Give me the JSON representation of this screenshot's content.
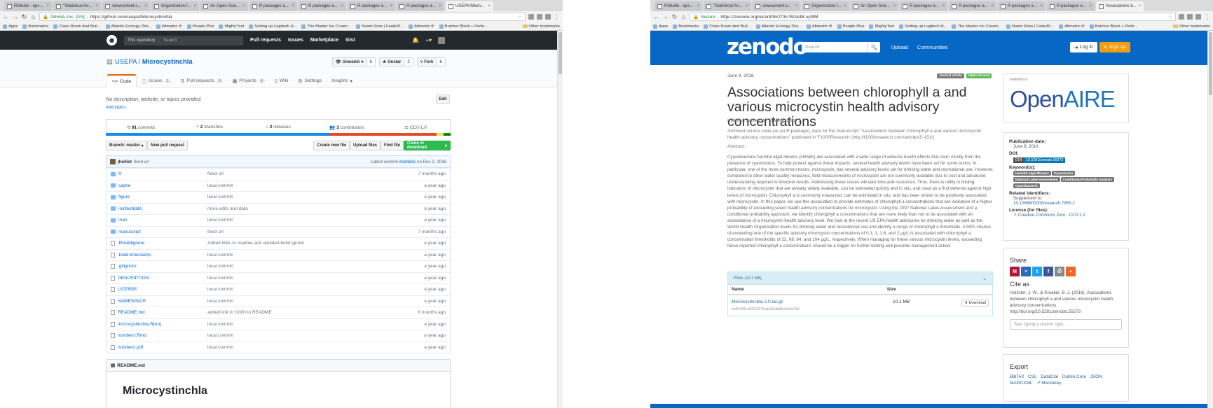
{
  "left": {
    "tabs": [
      "RStudio - eps...",
      "\"Statistical An...",
      "viewcontent.c...",
      "Organization f...",
      "An Open Scie...",
      "R packages a...",
      "R packages a...",
      "R packages a...",
      "R packages a...",
      "USEPA/Micro..."
    ],
    "url_owner": "GitHub, Inc. [US]",
    "url": "https://github.com/usepa/Microcystinchla",
    "bookmarks": [
      "Apps",
      "Bookmarks",
      "Class Room And Buil...",
      "Atlantic Ecology Divi...",
      "Altmetric it!",
      "People Plus",
      "MightyText",
      "Setting up Logitech H...",
      "The Master Ice Cream...",
      "Noam Ross | FasteR!...",
      "Altmetric it!",
      "Butcher Block + Perfe..."
    ],
    "other_bookmarks": "Other bookmarks",
    "gh": {
      "search_ctx": "This repository",
      "search_ph": "Search",
      "nav": [
        "Pull requests",
        "Issues",
        "Marketplace",
        "Gist"
      ],
      "owner": "USEPA",
      "sep": "/",
      "repo": "Microcystinchla",
      "unwatch": "Unwatch",
      "unwatch_n": "5",
      "unstar": "Unstar",
      "unstar_n": "2",
      "fork": "Fork",
      "fork_n": "6",
      "tabs": [
        {
          "label": "Code"
        },
        {
          "label": "Issues",
          "count": "1"
        },
        {
          "label": "Pull requests",
          "count": "0"
        },
        {
          "label": "Projects",
          "count": "0"
        },
        {
          "label": "Wiki"
        },
        {
          "label": "Settings"
        },
        {
          "label": "Insights"
        }
      ],
      "description": "No description, website, or topics provided.",
      "add_topics": "Add topics",
      "edit": "Edit",
      "commits_n": "91",
      "commits": "commits",
      "branches_n": "2",
      "branches": "branches",
      "releases_n": "2",
      "releases": "releases",
      "contributors_n": "3",
      "contributors": "contributors",
      "license": "CC0-1.0",
      "branch": "Branch: master",
      "new_pr": "New pull request",
      "create_file": "Create new file",
      "upload": "Upload files",
      "find": "Find file",
      "clone": "Clone or download",
      "commit_author": "jhollist",
      "commit_msg": "fixed url",
      "latest_commit": "Latest commit",
      "commit_sha": "ebeb8dc",
      "commit_date": "on Dec 2, 2016",
      "files": [
        {
          "name": "R",
          "msg": "fixed url",
          "age": "7 months ago",
          "dir": true
        },
        {
          "name": "cache",
          "msg": "local commit",
          "age": "a year ago",
          "dir": true
        },
        {
          "name": "figure",
          "msg": "local commit",
          "age": "a year ago",
          "dir": true
        },
        {
          "name": "inst/extdata",
          "msg": "more edits and data",
          "age": "a year ago",
          "dir": true
        },
        {
          "name": "man",
          "msg": "local commit",
          "age": "a year ago",
          "dir": true
        },
        {
          "name": "manuscript",
          "msg": "fixed url",
          "age": "7 months ago",
          "dir": true
        },
        {
          "name": ".Rbuildignore",
          "msg": "Added links to readme and updated build ignore",
          "age": "a year ago",
          "dir": false
        },
        {
          "name": ".build.timestamp",
          "msg": "local commit",
          "age": "a year ago",
          "dir": false
        },
        {
          "name": ".gitignore",
          "msg": "local commit",
          "age": "a year ago",
          "dir": false
        },
        {
          "name": "DESCRIPTION",
          "msg": "local commit",
          "age": "a year ago",
          "dir": false
        },
        {
          "name": "LICENSE",
          "msg": "local commit",
          "age": "a year ago",
          "dir": false
        },
        {
          "name": "NAMESPACE",
          "msg": "local commit",
          "age": "a year ago",
          "dir": false
        },
        {
          "name": "README.md",
          "msg": "added link to f1000 to README",
          "age": "8 months ago",
          "dir": false
        },
        {
          "name": "microcystinchla.Rproj",
          "msg": "local commit",
          "age": "a year ago",
          "dir": false
        },
        {
          "name": "numbers.Rmd",
          "msg": "local commit",
          "age": "a year ago",
          "dir": false
        },
        {
          "name": "numbers.pdf",
          "msg": "local commit",
          "age": "a year ago",
          "dir": false
        }
      ],
      "readme_file": "README.md",
      "readme_title": "Microcystinchla",
      "lang_colors": [
        "#198ce7",
        "#e34c26",
        "#f1e05a",
        "#178600"
      ]
    }
  },
  "right": {
    "tabs": [
      "RStudio - eps...",
      "\"Statistical An...",
      "viewcontent.c...",
      "Organization f...",
      "An Open Scie...",
      "R packages a...",
      "R packages a...",
      "R packages a...",
      "R packages a...",
      "Associations b..."
    ],
    "secure": "Secure",
    "url": "https://zenodo.org/record/55273#.WUk4B-vyt9M",
    "bookmarks": [
      "Apps",
      "Bookmarks",
      "Class Room And Buil...",
      "Atlantic Ecology Divi...",
      "Altmetric it!",
      "People Plus",
      "MightyText",
      "Setting up Logitech H...",
      "The Master Ice Cream...",
      "Noam Ross | FasteR!...",
      "Altmetric it!",
      "Butcher Block + Perfe..."
    ],
    "other_bookmarks": "Other bookmarks",
    "z": {
      "logo": "zenodo",
      "search_ph": "Search",
      "nav": [
        "Upload",
        "Communities"
      ],
      "login": "Log in",
      "signup": "Sign up",
      "date": "June 9, 2016",
      "badge1": "Journal article",
      "badge2": "Open Access",
      "title": "Associations between chlorophyll a and various microcystin health advisory concentrations",
      "authors": "Hollister, Jeffrey W.; Kreakie, Betty J.",
      "blurb": "Archived source code (as an R package), data for the manuscript \"Associations between chlorophyll a and various microcystin health advisory concentrations\" published in F1000Research (http://f1000research.com/articles/5-151/)",
      "abstract_h": "Abstract:",
      "abstract": "Cyanobacteria harmful algal blooms (cHABs) are associated with a wide range of adverse health effects that stem mostly from the presence of cyanotoxins. To help protect against these impacts, several health advisory levels have been set for some toxins. In particular, one of the more common toxins, microcystin, has several advisory levels set for drinking water and recreational use. However, compared to other water quality measures, field measurements of microcystin are not commonly available due to cost and advanced understanding required to interpret results. Addressing these issues will take time and resources. Thus, there is utility in finding indicators of microcystin that are already widely available, can be estimated quickly and in situ, and used as a first defense against high levels of microcystin. Chlorophyll a is commonly measured, can be estimated in situ, and has been shown to be positively associated with microcystin. In this paper, we use this association to provide estimates of chlorophyll a concentrations that are indicative of a higher probability of exceeding select health advisory concentrations for microcystin. Using the 2007 National Lakes Assessment and a conditional probability approach, we identify chlorophyll a concentrations that are more likely than not to be associated with an exceedance of a microcystin health advisory level. We look at the recent US EPA health advisories for drinking water as well as the World Health Organization levels for drinking water and recreational use and identify a range of chlorophyll a thresholds. A 50% chance of exceeding one of the specific advisory microcystin concentrations of 0.3, 1, 1.6, and 2 μg/L is associated with chlorophyll a concentration thresholds of 23, 68, 84, and 104 μg/L, respectively. When managing for these various microcystin levels, exceeding these reported chlorophyll a concentrations should be a trigger for further testing and possible management action.",
      "files_h": "Files",
      "files_size": "(10.1 MB)",
      "col_name": "Name",
      "col_size": "Size",
      "file_name": "Microcystinchla-2.0.tar.gz",
      "file_md5": "md5:608ca6316627faab1d1a8dfac8cde19d",
      "file_size": "10.1 MB",
      "download": "Download",
      "indexed_in": "Indexed in",
      "openaire_a": "Open",
      "openaire_b": "AIRE",
      "pubdate_h": "Publication date:",
      "pubdate": "June 9, 2016",
      "doi_h": "DOI:",
      "doi_l": "DOI",
      "doi": "10.5281/zenodo.55273",
      "kw_h": "Keyword(s):",
      "keywords": [
        "Harmful Algal Blooms",
        "Cyanotoxins",
        "National Lakes Assessment",
        "Conditional Probability Analysis",
        "Cyanobacteria"
      ],
      "rel_h": "Related identifiers:",
      "supp": "Supplement to:",
      "supp_link": "10.12688/f1000research.7955.2",
      "lic_h": "License (for files):",
      "lic": "Creative Commons Zero - CC0 1.0",
      "share_h": "Share",
      "cite_h": "Cite as",
      "cite": "Hollister, J. W., & Kreakie, B. J. (2016). Associations between chlorophyll a and various microcystin health advisory concentrations. http://doi.org/10.5281/zenodo.55273",
      "cite_ph": "Start typing a citation style...",
      "export_h": "Export",
      "exports": [
        "BibTeX",
        "CSL",
        "DataCite",
        "Dublin Core",
        "JSON",
        "MARCXML",
        "Mendeley"
      ]
    }
  }
}
